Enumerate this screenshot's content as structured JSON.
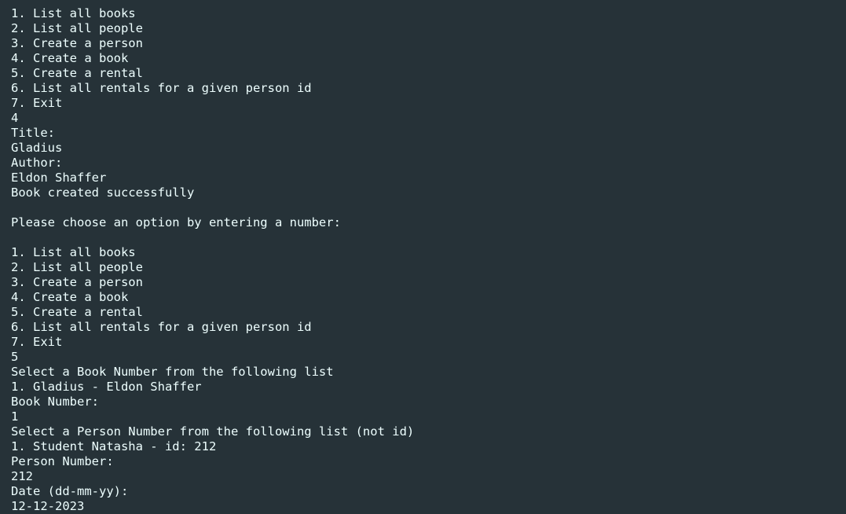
{
  "terminal": {
    "lines": [
      "1. List all books",
      "2. List all people",
      "3. Create a person",
      "4. Create a book",
      "5. Create a rental",
      "6. List all rentals for a given person id",
      "7. Exit",
      "4",
      "Title:",
      "Gladius",
      "Author:",
      "Eldon Shaffer",
      "Book created successfully",
      "",
      "Please choose an option by entering a number:",
      "",
      "1. List all books",
      "2. List all people",
      "3. Create a person",
      "4. Create a book",
      "5. Create a rental",
      "6. List all rentals for a given person id",
      "7. Exit",
      "5",
      "Select a Book Number from the following list",
      "1. Gladius - Eldon Shaffer",
      "Book Number:",
      "1",
      "Select a Person Number from the following list (not id)",
      "1. Student Natasha - id: 212",
      "Person Number:",
      "212",
      "Date (dd-mm-yy):",
      "12-12-2023"
    ]
  }
}
